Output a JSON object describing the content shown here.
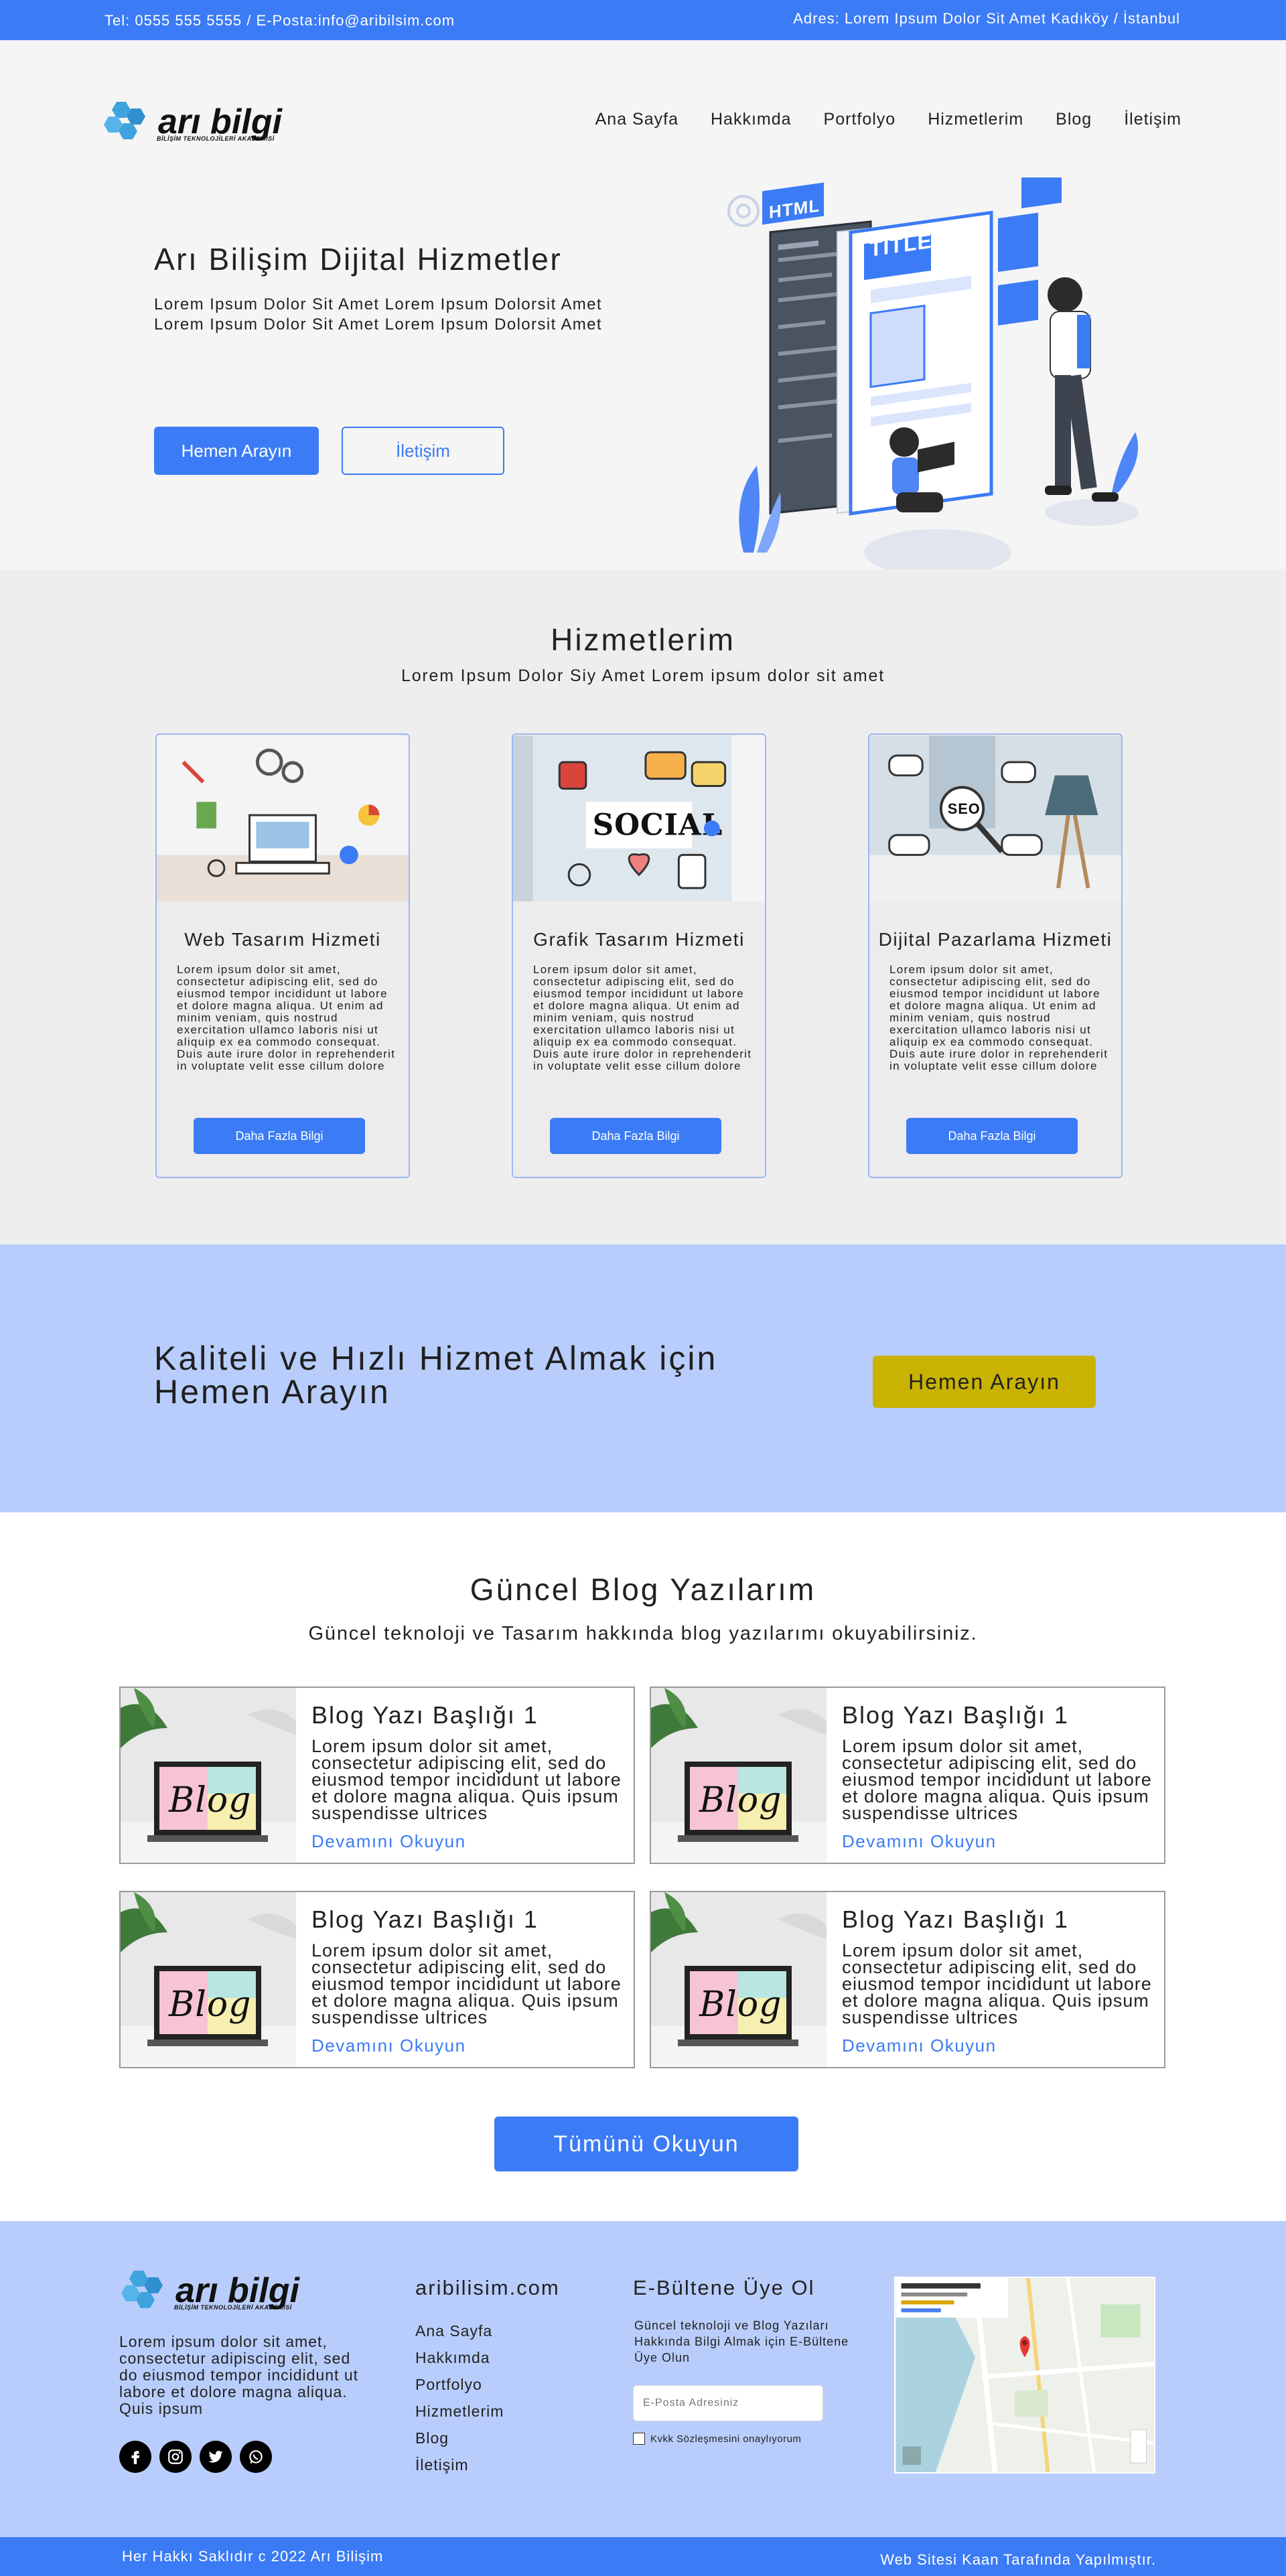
{
  "topbar": {
    "contact": "Tel: 0555 555 5555 / E-Posta:info@aribilsim.com",
    "address": "Adres: Lorem Ipsum Dolor Sit Amet Kadıköy / İstanbul"
  },
  "logo": {
    "word": "arı bilgi",
    "tagline": "BİLİŞİM TEKNOLOJİLERİ AKADEMİSİ"
  },
  "nav": [
    "Ana Sayfa",
    "Hakkımda",
    "Portfolyo",
    "Hizmetlerim",
    "Blog",
    "İletişim"
  ],
  "hero": {
    "title": "Arı Bilişim Dijital Hizmetler",
    "subtitle": "Lorem Ipsum Dolor Sit Amet Lorem Ipsum Dolorsit Amet Lorem Ipsum Dolor Sit Amet Lorem Ipsum Dolorsit Amet",
    "primary_button": "Hemen Arayın",
    "secondary_button": "İletişim",
    "illustration_labels": [
      "HTML",
      "TITLE"
    ]
  },
  "services": {
    "title": "Hizmetlerim",
    "subtitle": "Lorem Ipsum Dolor Siy Amet Lorem ipsum dolor sit amet",
    "cards": [
      {
        "title": "Web Tasarım Hizmeti",
        "body": "Lorem ipsum dolor sit amet, consectetur adipiscing elit, sed do eiusmod tempor incididunt ut labore et dolore magna aliqua. Ut enim ad minim veniam, quis nostrud exercitation ullamco laboris nisi ut aliquip ex ea commodo consequat. Duis aute irure dolor in reprehenderit in voluptate velit esse cillum dolore",
        "button": "Daha Fazla Bilgi"
      },
      {
        "title": "Grafik Tasarım Hizmeti",
        "body": "Lorem ipsum dolor sit amet, consectetur adipiscing elit, sed do eiusmod tempor incididunt ut labore et dolore magna aliqua. Ut enim ad minim veniam, quis nostrud exercitation ullamco laboris nisi ut aliquip ex ea commodo consequat. Duis aute irure dolor in reprehenderit in voluptate velit esse cillum dolore",
        "button": "Daha Fazla Bilgi"
      },
      {
        "title": "Dijital Pazarlama Hizmeti",
        "body": "Lorem ipsum dolor sit amet, consectetur adipiscing elit, sed do eiusmod tempor incididunt ut labore et dolore magna aliqua. Ut enim ad minim veniam, quis nostrud exercitation ullamco laboris nisi ut aliquip ex ea commodo consequat. Duis aute irure dolor in reprehenderit in voluptate velit esse cillum dolore",
        "button": "Daha Fazla Bilgi"
      }
    ]
  },
  "cta": {
    "text": "Kaliteli ve Hızlı Hizmet Almak için Hemen Arayın",
    "button": "Hemen Arayın"
  },
  "blog": {
    "title": "Güncel Blog Yazılarım",
    "subtitle": "Güncel teknoloji ve Tasarım hakkında blog yazılarımı okuyabilirsiniz.",
    "image_label": "Blog",
    "posts": [
      {
        "title": "Blog Yazı Başlığı 1",
        "body": "Lorem ipsum dolor sit amet, consectetur adipiscing elit, sed do eiusmod tempor incididunt ut labore et dolore magna aliqua. Quis ipsum suspendisse ultrices",
        "link": "Devamını Okuyun"
      },
      {
        "title": "Blog Yazı Başlığı 1",
        "body": "Lorem ipsum dolor sit amet, consectetur adipiscing elit, sed do eiusmod tempor incididunt ut labore et dolore magna aliqua. Quis ipsum suspendisse ultrices",
        "link": "Devamını Okuyun"
      },
      {
        "title": "Blog Yazı Başlığı 1",
        "body": "Lorem ipsum dolor sit amet, consectetur adipiscing elit, sed do eiusmod tempor incididunt ut labore et dolore magna aliqua. Quis ipsum suspendisse ultrices",
        "link": "Devamını Okuyun"
      },
      {
        "title": "Blog Yazı Başlığı 1",
        "body": "Lorem ipsum dolor sit amet, consectetur adipiscing elit, sed do eiusmod tempor incididunt ut labore et dolore magna aliqua. Quis ipsum suspendisse ultrices",
        "link": "Devamını Okuyun"
      }
    ],
    "all_button": "Tümünü Okuyun"
  },
  "footer": {
    "about": "Lorem ipsum dolor sit amet, consectetur adipiscing elit, sed do eiusmod tempor incididunt ut labore et dolore magna aliqua. Quis ipsum",
    "site_title": "aribilisim.com",
    "links": [
      "Ana Sayfa",
      "Hakkımda",
      "Portfolyo",
      "Hizmetlerim",
      "Blog",
      "İletişim"
    ],
    "newsletter_title": "E-Bültene Üye Ol",
    "newsletter_text": "Güncel teknoloji ve Blog Yazıları Hakkında Bilgi Almak için E-Bültene Üye Olun",
    "email_placeholder": "E-Posta Adresiniz",
    "consent_label": "Kvkk Sözleşmesini onaylıyorum",
    "social_icons": [
      "facebook-icon",
      "instagram-icon",
      "twitter-icon",
      "whatsapp-icon"
    ]
  },
  "bottombar": {
    "copyright": "Her Hakkı  Saklıdır c 2022 Arı Bilişim",
    "credit": "Web Sitesi Kaan Tarafında Yapılmıştır."
  },
  "colors": {
    "accent": "#3b7bf5",
    "cta_background": "#b8cdfb",
    "cta_button": "#c9b300",
    "hero_background": "#f5f5f5",
    "services_background": "#eeeeee"
  }
}
